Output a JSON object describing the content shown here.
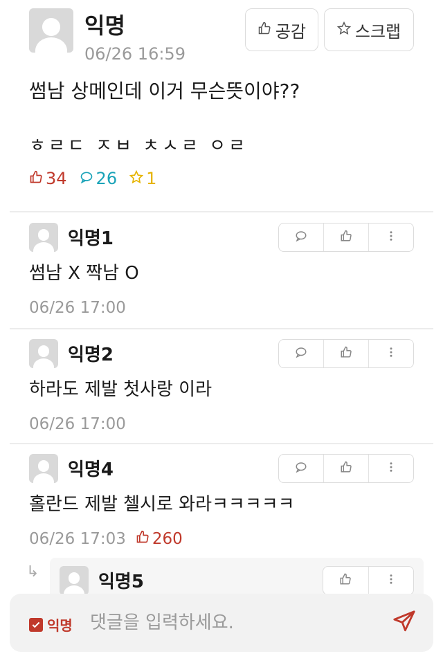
{
  "post": {
    "author": "익명",
    "time": "06/26 16:59",
    "like_button": "공감",
    "scrap_button": "스크랩",
    "title": "썸남 상메인데 이거 무슨뜻이야??",
    "body": "ㅎㄹㄷ ㅈㅂ ㅊㅅㄹ ㅇㄹ",
    "stats": {
      "likes": "34",
      "comments": "26",
      "scraps": "1"
    }
  },
  "comments": [
    {
      "author": "익명1",
      "text": "썸남 X 짝남 O",
      "time": "06/26 17:00",
      "likes": ""
    },
    {
      "author": "익명2",
      "text": "하라도 제발 첫사랑 이라",
      "time": "06/26 17:00",
      "likes": ""
    },
    {
      "author": "익명4",
      "text": "홀란드 제발 첼시로 와라ㅋㅋㅋㅋㅋ",
      "time": "06/26 17:03",
      "likes": "260"
    }
  ],
  "reply": {
    "author": "익명5"
  },
  "input": {
    "anonymous_label": "익명",
    "placeholder": "댓글을 입력하세요."
  },
  "colors": {
    "accent": "#c0392b",
    "comment_stat": "#1aa3b8",
    "scrap_stat": "#e6b400"
  }
}
